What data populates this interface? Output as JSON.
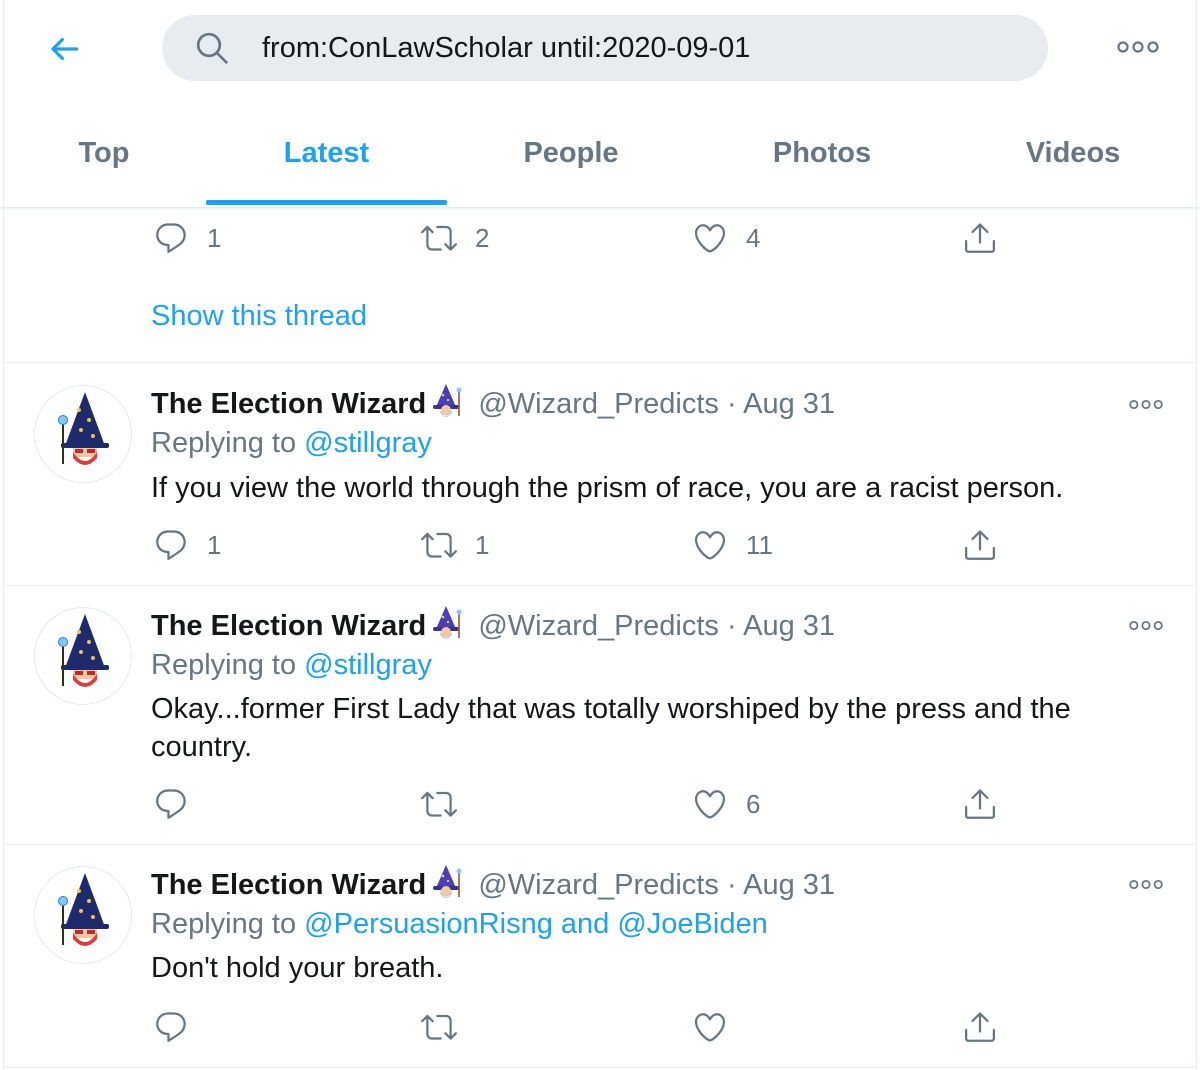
{
  "search": {
    "query": "from:ConLawScholar until:2020-09-01"
  },
  "icons": {
    "back": "arrow-left-icon",
    "search": "search-icon",
    "more": "more-horizontal-icon",
    "reply": "reply-bubble-icon",
    "retweet": "retweet-icon",
    "like": "heart-icon",
    "share": "share-upload-icon"
  },
  "colors": {
    "accent": "#1da1f2",
    "secondary_text": "#657786",
    "primary_text": "#14171a",
    "search_bg": "#e6ecf0"
  },
  "tabs": [
    {
      "label": "Top",
      "active": false
    },
    {
      "label": "Latest",
      "active": true
    },
    {
      "label": "People",
      "active": false
    },
    {
      "label": "Photos",
      "active": false
    },
    {
      "label": "Videos",
      "active": false
    }
  ],
  "first_tweet_actions": {
    "replies": "1",
    "retweets": "2",
    "likes": "4"
  },
  "show_thread": "Show this thread",
  "tweets": [
    {
      "display_name": "The Election Wizard",
      "handle": "@Wizard_Predicts",
      "separator": "·",
      "date": "Aug 31",
      "replying_prefix": "Replying to",
      "mention_1": "@stillgray",
      "text": "If you view the world through the prism of race, you are a racist person.",
      "replies": "1",
      "retweets": "1",
      "likes": "11"
    },
    {
      "display_name": "The Election Wizard",
      "handle": "@Wizard_Predicts",
      "separator": "·",
      "date": "Aug 31",
      "replying_prefix": "Replying to",
      "mention_1": "@stillgray",
      "text": "Okay...former First Lady that was totally worshiped by the press and the country.",
      "replies": "",
      "retweets": "",
      "likes": "6"
    },
    {
      "display_name": "The Election Wizard",
      "handle": "@Wizard_Predicts",
      "separator": "·",
      "date": "Aug 31",
      "replying_prefix": "Replying to",
      "mention_1": "@PersuasionRisng",
      "mention_joiner": "and",
      "mention_2": "@JoeBiden",
      "text": "Don't hold your breath.",
      "replies": "",
      "retweets": "",
      "likes": ""
    }
  ],
  "avatar_caption": "THE ELECTION WIZARD"
}
